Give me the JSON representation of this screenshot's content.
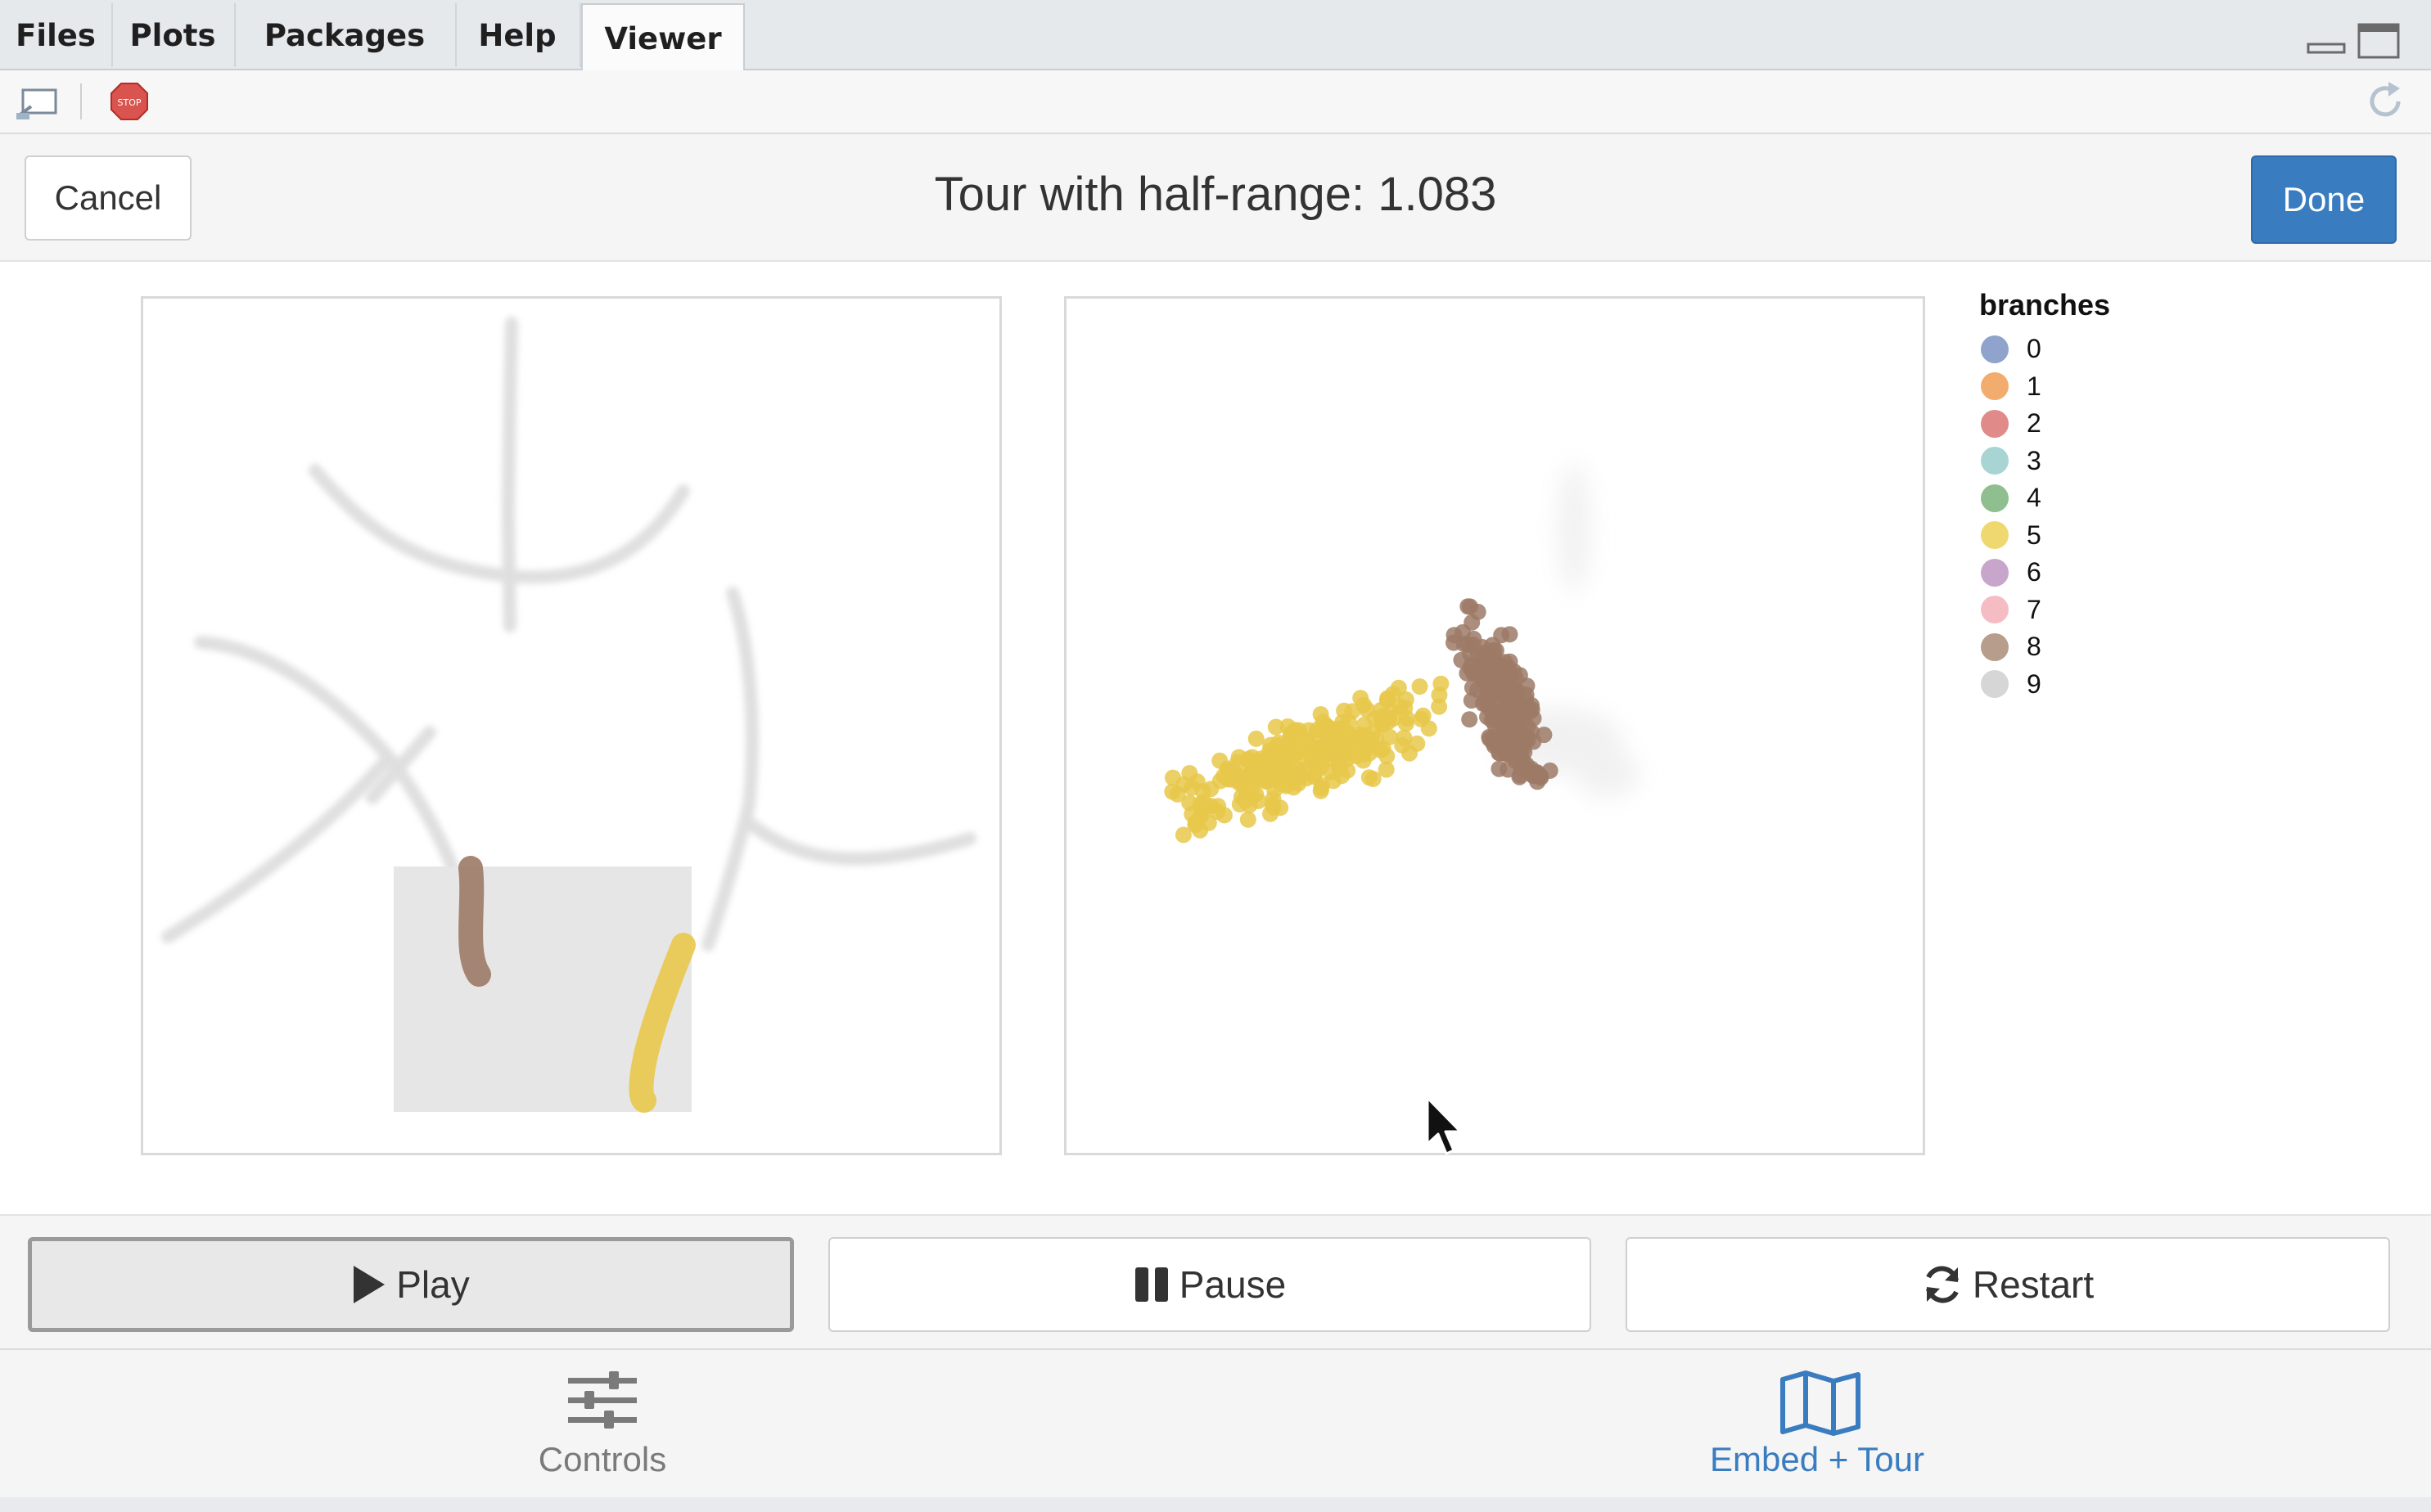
{
  "tabs": [
    {
      "label": "Files",
      "active": false
    },
    {
      "label": "Plots",
      "active": false
    },
    {
      "label": "Packages",
      "active": false
    },
    {
      "label": "Help",
      "active": false
    },
    {
      "label": "Viewer",
      "active": true
    }
  ],
  "toolbar": {
    "icons": [
      "presentation-icon",
      "stop-icon",
      "refresh-icon"
    ],
    "stop_badge": "STOP"
  },
  "gadget": {
    "cancel_label": "Cancel",
    "title": "Tour with half-range: 1.083",
    "done_label": "Done"
  },
  "legend": {
    "title": "branches",
    "items": [
      {
        "label": "0",
        "color": "#8fa3cc"
      },
      {
        "label": "1",
        "color": "#f2ad6e"
      },
      {
        "label": "2",
        "color": "#e08a8a"
      },
      {
        "label": "3",
        "color": "#a9d4d4"
      },
      {
        "label": "4",
        "color": "#8fbf8f"
      },
      {
        "label": "5",
        "color": "#f0d870"
      },
      {
        "label": "6",
        "color": "#c8a6cc"
      },
      {
        "label": "7",
        "color": "#f6bcc4"
      },
      {
        "label": "8",
        "color": "#b69d8c"
      },
      {
        "label": "9",
        "color": "#d6d6d6"
      }
    ]
  },
  "controls": {
    "play_label": "Play",
    "pause_label": "Pause",
    "restart_label": "Restart",
    "pressed": "Play"
  },
  "nav": [
    {
      "label": "Controls",
      "icon": "sliders-icon",
      "active": false
    },
    {
      "label": "Embed + Tour",
      "icon": "map-icon",
      "active": true
    }
  ],
  "colors": {
    "accent": "#3a7cc0",
    "highlight_yellow": "#e8c84a",
    "highlight_brown": "#9c7a66",
    "faded_gray": "#d4d4d4",
    "brush_fill": "#e6e6e6"
  }
}
